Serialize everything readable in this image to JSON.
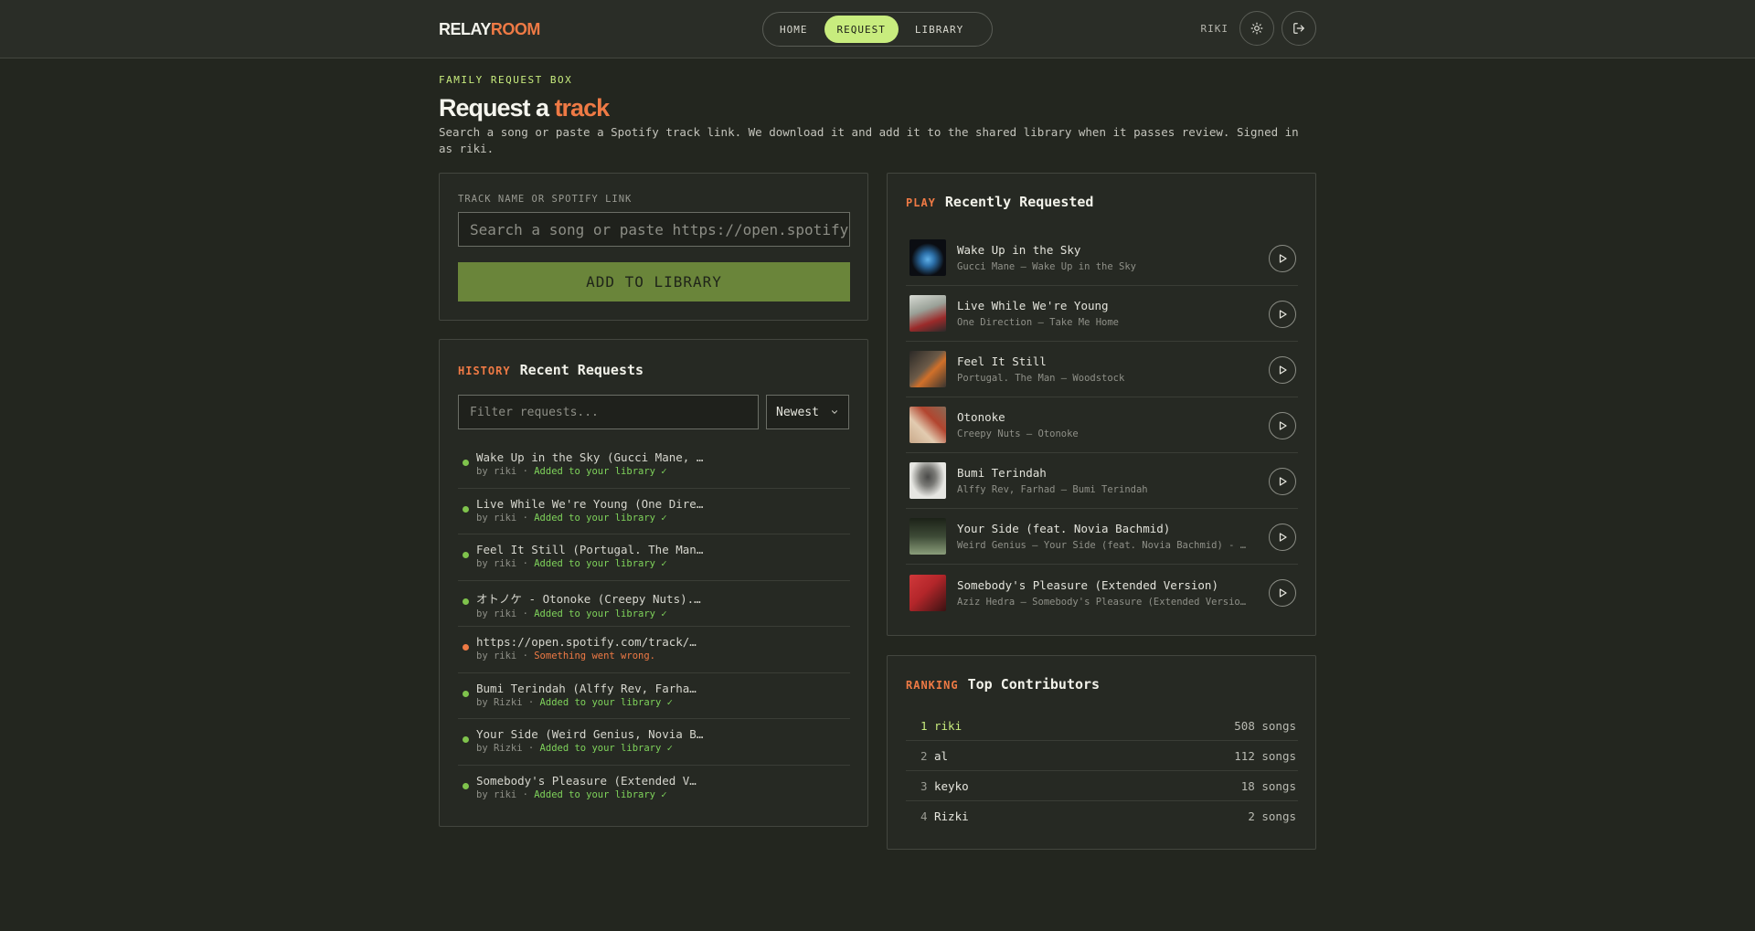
{
  "brand": {
    "part1": "RELAY",
    "part2": "ROOM"
  },
  "nav": {
    "items": [
      {
        "label": "HOME"
      },
      {
        "label": "REQUEST"
      },
      {
        "label": "LIBRARY"
      }
    ],
    "active": "REQUEST"
  },
  "user": {
    "name": "RIKI",
    "theme_icon": "sun-icon",
    "logout_icon": "logout-icon"
  },
  "hero": {
    "eyebrow": "FAMILY REQUEST BOX",
    "title_plain": "Request a",
    "title_accent": "track",
    "lead": "Search a song or paste a Spotify track link. We download it and add it to the shared library when it passes review. Signed in as riki."
  },
  "request_form": {
    "label": "TRACK NAME OR SPOTIFY LINK",
    "placeholder": "Search a song or paste https://open.spotify.com/track/...",
    "button": "ADD TO LIBRARY"
  },
  "history": {
    "tag": "HISTORY",
    "title": "Recent Requests",
    "filter_placeholder": "Filter requests...",
    "sort_value": "Newest",
    "items": [
      {
        "title": "Wake Up in the Sky (Gucci Mane, …",
        "by": "by riki",
        "status": "Added to your library ✓",
        "state": "ok"
      },
      {
        "title": "Live While We're Young (One Dire…",
        "by": "by riki",
        "status": "Added to your library ✓",
        "state": "ok"
      },
      {
        "title": "Feel It Still (Portugal. The Man…",
        "by": "by riki",
        "status": "Added to your library ✓",
        "state": "ok"
      },
      {
        "title": "オトノケ - Otonoke (Creepy Nuts).…",
        "by": "by riki",
        "status": "Added to your library ✓",
        "state": "ok"
      },
      {
        "title": "https://open.spotify.com/track/…",
        "by": "by riki",
        "status": "Something went wrong.",
        "state": "err"
      },
      {
        "title": "Bumi Terindah (Alffy Rev, Farha…",
        "by": "by Rizki",
        "status": "Added to your library ✓",
        "state": "ok"
      },
      {
        "title": "Your Side (Weird Genius, Novia B…",
        "by": "by Rizki",
        "status": "Added to your library ✓",
        "state": "ok"
      },
      {
        "title": "Somebody's Pleasure (Extended V…",
        "by": "by riki",
        "status": "Added to your library ✓",
        "state": "ok"
      }
    ]
  },
  "recent": {
    "tag": "PLAY",
    "title": "Recently Requested",
    "tracks": [
      {
        "title": "Wake Up in the Sky",
        "sub": "Gucci Mane — Wake Up in the Sky",
        "art": [
          "#0b0d12",
          "#2c6fa8"
        ]
      },
      {
        "title": "Live While We're Young",
        "sub": "One Direction — Take Me Home",
        "art": [
          "#b8bcb5",
          "#9b2a2a"
        ]
      },
      {
        "title": "Feel It Still",
        "sub": "Portugal. The Man — Woodstock",
        "art": [
          "#3a3530",
          "#d0702a"
        ]
      },
      {
        "title": "Otonoke",
        "sub": "Creepy Nuts — Otonoke",
        "art": [
          "#c9a98a",
          "#b2452f"
        ]
      },
      {
        "title": "Bumi Terindah",
        "sub": "Alffy Rev, Farhad — Bumi Terindah",
        "art": [
          "#e6e6e2",
          "#4a4a48"
        ]
      },
      {
        "title": "Your Side (feat. Novia Bachmid)",
        "sub": "Weird Genius — Your Side (feat. Novia Bachmid) - Single",
        "art": [
          "#1c2218",
          "#8a9d7a"
        ]
      },
      {
        "title": "Somebody's Pleasure (Extended Version)",
        "sub": "Aziz Hedra — Somebody's Pleasure (Extended Version) - Single",
        "art": [
          "#b3262a",
          "#3a1212"
        ]
      }
    ]
  },
  "ranking": {
    "tag": "RANKING",
    "title": "Top Contributors",
    "rows": [
      {
        "rank": "1",
        "name": "riki",
        "count": "508 songs"
      },
      {
        "rank": "2",
        "name": "al",
        "count": "112 songs"
      },
      {
        "rank": "3",
        "name": "keyko",
        "count": "18 songs"
      },
      {
        "rank": "4",
        "name": "Rizki",
        "count": "2 songs"
      }
    ]
  },
  "colors": {
    "accent_green": "#c8ec7e",
    "accent_orange": "#ef7a45",
    "button_green": "#6a853a",
    "background": "#23261f"
  }
}
